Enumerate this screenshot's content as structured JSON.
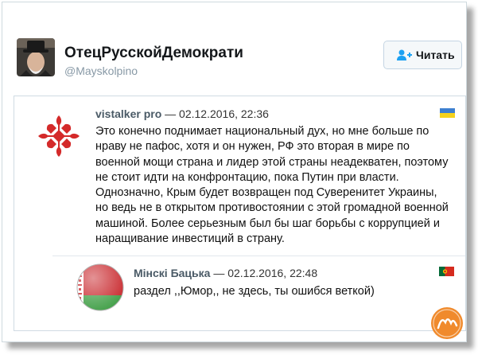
{
  "tweet": {
    "author_name": "ОтецРусскойДемократи",
    "author_handle": "@Mayskolpino",
    "follow_label": "Читать"
  },
  "comments": [
    {
      "author": "vistalker pro",
      "separator": " — ",
      "date": "02.12.2016, 22:36",
      "flag": "ukraine-flag",
      "text": "Это конечно поднимает национальный дух, но мне больше по нраву не пафос, хотя и он нужен, РФ это вторая в мире по военной мощи страна и лидер этой страны неадекватен, поэтому не стоит идти на конфронтацию, пока Путин при власти. Однозначно, Крым будет возвращен под Суверенитет Украины, но ведь не в открытом противостоянии с этой громадной военной машиной. Более серьезным был бы шаг борьбы с коррупцией и наращивание инвестиций в страну."
    },
    {
      "author": "Мінскі Бацька",
      "separator": " — ",
      "date": "02.12.2016, 22:48",
      "flag": "portugal-flag",
      "text": "раздел ,,Юмор,, не здесь, ты ошибся веткой)"
    }
  ],
  "colors": {
    "author": "#4a5a66",
    "handle": "#8899a6",
    "border": "#d0dbe3",
    "cross_red": "#d42a2a",
    "belarus_red": "#c8262b",
    "belarus_green": "#3f9e45"
  },
  "watermark": {
    "icon": "watermark-logo"
  }
}
